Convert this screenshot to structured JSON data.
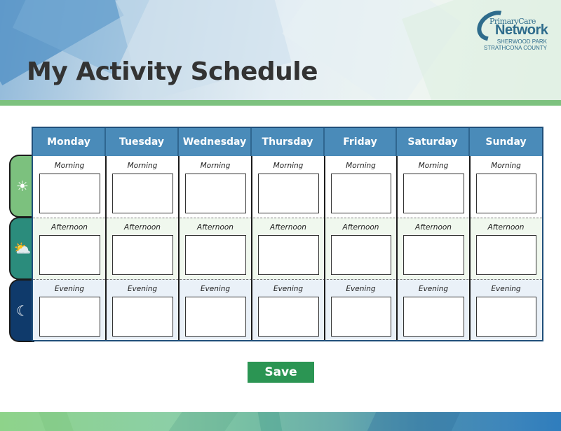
{
  "page": {
    "title": "My Activity Schedule"
  },
  "logo": {
    "line_small": "PrimaryCare",
    "line_big": "Network",
    "line_sub1": "SHERWOOD PARK",
    "line_sub2": "STRATHCONA COUNTY"
  },
  "schedule": {
    "days": [
      "Monday",
      "Tuesday",
      "Wednesday",
      "Thursday",
      "Friday",
      "Saturday",
      "Sunday"
    ],
    "periods": [
      {
        "label": "Morning",
        "icon": "sun-icon",
        "glyph": "☀",
        "color": "#7cc17e"
      },
      {
        "label": "Afternoon",
        "icon": "sun-cloud-icon",
        "glyph": "⛅",
        "color": "#2b8c7c"
      },
      {
        "label": "Evening",
        "icon": "moon-icon",
        "glyph": "☾",
        "color": "#0f3a6b"
      }
    ],
    "entries": {
      "Monday": {
        "Morning": "",
        "Afternoon": "",
        "Evening": ""
      },
      "Tuesday": {
        "Morning": "",
        "Afternoon": "",
        "Evening": ""
      },
      "Wednesday": {
        "Morning": "",
        "Afternoon": "",
        "Evening": ""
      },
      "Thursday": {
        "Morning": "",
        "Afternoon": "",
        "Evening": ""
      },
      "Friday": {
        "Morning": "",
        "Afternoon": "",
        "Evening": ""
      },
      "Saturday": {
        "Morning": "",
        "Afternoon": "",
        "Evening": ""
      },
      "Sunday": {
        "Morning": "",
        "Afternoon": "",
        "Evening": ""
      }
    }
  },
  "actions": {
    "save_label": "Save"
  },
  "colors": {
    "header_blue": "#4a8bb9",
    "accent_green": "#7dc27f",
    "save_green": "#2b9553",
    "title_text": "#333333"
  }
}
